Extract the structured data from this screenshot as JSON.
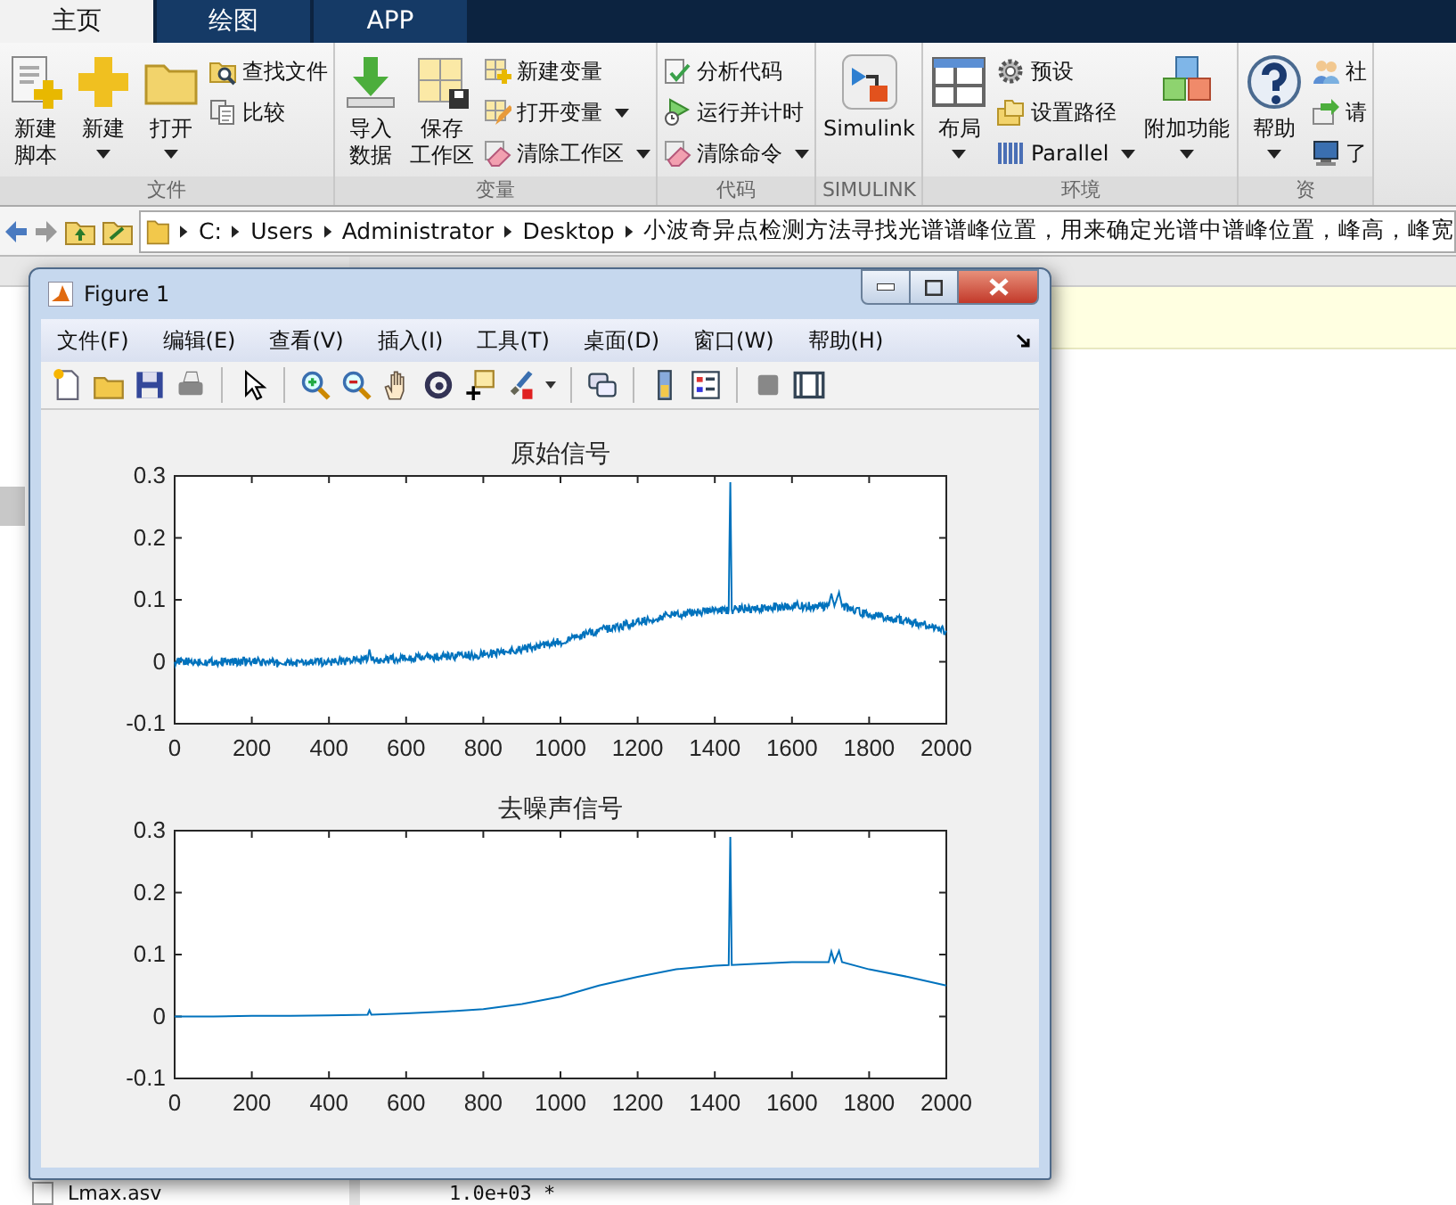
{
  "tabs": [
    {
      "label": "主页",
      "selected": true
    },
    {
      "label": "绘图",
      "selected": false
    },
    {
      "label": "APP",
      "selected": false
    }
  ],
  "toolstrip": [
    {
      "title": "文件",
      "items": [
        {
          "kind": "large",
          "lines": [
            "新建",
            "脚本"
          ],
          "dropdown": false
        },
        {
          "kind": "large",
          "lines": [
            "新建"
          ],
          "dropdown": true
        },
        {
          "kind": "large",
          "lines": [
            "打开"
          ],
          "dropdown": true
        },
        {
          "kind": "stack",
          "entries": [
            {
              "label": "查找文件",
              "dropdown": false
            },
            {
              "label": "比较",
              "dropdown": false
            }
          ]
        }
      ]
    },
    {
      "title": "变量",
      "items": [
        {
          "kind": "large",
          "lines": [
            "导入",
            "数据"
          ],
          "dropdown": false
        },
        {
          "kind": "large",
          "lines": [
            "保存",
            "工作区"
          ],
          "dropdown": false
        },
        {
          "kind": "stack",
          "entries": [
            {
              "label": "新建变量",
              "dropdown": false
            },
            {
              "label": "打开变量",
              "dropdown": true
            },
            {
              "label": "清除工作区",
              "dropdown": true
            }
          ]
        }
      ]
    },
    {
      "title": "代码",
      "items": [
        {
          "kind": "stack",
          "entries": [
            {
              "label": "分析代码",
              "dropdown": false
            },
            {
              "label": "运行并计时",
              "dropdown": false
            },
            {
              "label": "清除命令",
              "dropdown": true
            }
          ]
        }
      ]
    },
    {
      "title": "SIMULINK",
      "items": [
        {
          "kind": "large",
          "lines": [
            "Simulink"
          ],
          "dropdown": false
        }
      ]
    },
    {
      "title": "环境",
      "items": [
        {
          "kind": "large",
          "lines": [
            "布局"
          ],
          "dropdown": true
        },
        {
          "kind": "stack",
          "entries": [
            {
              "label": "预设",
              "dropdown": false
            },
            {
              "label": "设置路径",
              "dropdown": false
            },
            {
              "label": "Parallel",
              "dropdown": true
            }
          ]
        },
        {
          "kind": "large",
          "lines": [
            "附加功能"
          ],
          "dropdown": true
        }
      ]
    },
    {
      "title": "资",
      "items": [
        {
          "kind": "large",
          "lines": [
            "帮助"
          ],
          "dropdown": true
        },
        {
          "kind": "stack",
          "entries": [
            {
              "label": "社",
              "dropdown": false
            },
            {
              "label": "请",
              "dropdown": false
            },
            {
              "label": "了",
              "dropdown": false
            }
          ]
        }
      ]
    }
  ],
  "address_bar": {
    "segments": [
      "C:",
      "Users",
      "Administrator",
      "Desktop",
      "小波奇异点检测方法寻找光谱谱峰位置，用来确定光谱中谱峰位置，峰高，峰宽"
    ]
  },
  "figure": {
    "title": "Figure 1",
    "menu": [
      "文件(F)",
      "编辑(E)",
      "查看(V)",
      "插入(I)",
      "工具(T)",
      "桌面(D)",
      "窗口(W)",
      "帮助(H)"
    ],
    "plots": [
      {
        "kind": "noisy",
        "chart_data": {
          "type": "line",
          "title": "原始信号",
          "xlim": [
            0,
            2000
          ],
          "ylim": [
            -0.1,
            0.3
          ],
          "xticks": [
            0,
            200,
            400,
            600,
            800,
            1000,
            1200,
            1400,
            1600,
            1800,
            2000
          ],
          "yticks": [
            -0.1,
            0,
            0.1,
            0.2,
            0.3
          ],
          "x": [
            0,
            100,
            200,
            300,
            400,
            500,
            505,
            510,
            600,
            700,
            800,
            900,
            1000,
            1100,
            1200,
            1300,
            1400,
            1436,
            1440,
            1444,
            1500,
            1600,
            1650,
            1695,
            1702,
            1710,
            1722,
            1730,
            1800,
            1900,
            2000
          ],
          "series": [
            {
              "color": "#0072bd",
              "values": [
                0,
                0,
                0,
                -0.003,
                0,
                0.003,
                0.02,
                0.003,
                0.005,
                0.008,
                0.012,
                0.02,
                0.032,
                0.05,
                0.064,
                0.077,
                0.083,
                0.084,
                0.29,
                0.084,
                0.087,
                0.09,
                0.09,
                0.09,
                0.11,
                0.09,
                0.112,
                0.09,
                0.076,
                0.066,
                0.05
              ]
            }
          ]
        }
      },
      {
        "kind": "smooth",
        "chart_data": {
          "type": "line",
          "title": "去噪声信号",
          "xlim": [
            0,
            2000
          ],
          "ylim": [
            -0.1,
            0.3
          ],
          "xticks": [
            0,
            200,
            400,
            600,
            800,
            1000,
            1200,
            1400,
            1600,
            1800,
            2000
          ],
          "yticks": [
            -0.1,
            0,
            0.1,
            0.2,
            0.3
          ],
          "x": [
            0,
            100,
            200,
            300,
            400,
            500,
            505,
            510,
            600,
            700,
            800,
            900,
            1000,
            1100,
            1200,
            1300,
            1400,
            1436,
            1440,
            1444,
            1500,
            1600,
            1650,
            1695,
            1702,
            1710,
            1722,
            1730,
            1800,
            1900,
            2000
          ],
          "series": [
            {
              "color": "#0072bd",
              "values": [
                0,
                0,
                0.001,
                0.001,
                0.002,
                0.003,
                0.01,
                0.003,
                0.005,
                0.008,
                0.012,
                0.02,
                0.032,
                0.05,
                0.064,
                0.076,
                0.082,
                0.083,
                0.29,
                0.083,
                0.085,
                0.088,
                0.088,
                0.088,
                0.105,
                0.088,
                0.106,
                0.088,
                0.076,
                0.064,
                0.05
              ]
            }
          ]
        }
      }
    ]
  },
  "file_list": [
    {
      "name": "Lmax.asv"
    }
  ],
  "command_output": "1.0e+03 *"
}
